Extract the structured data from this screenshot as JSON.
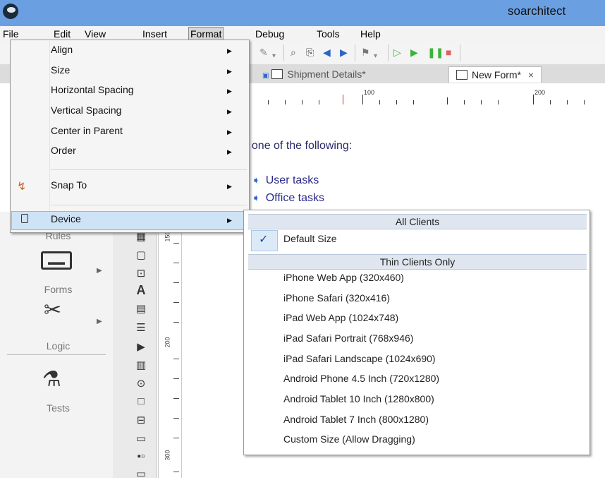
{
  "window": {
    "title": "soarchitect"
  },
  "menubar": {
    "items": [
      "File",
      "Edit",
      "View",
      "Insert",
      "Format",
      "Debug",
      "Tools",
      "Help"
    ]
  },
  "tabs": [
    {
      "label": "Shipment Details*"
    },
    {
      "label": "New Form*",
      "close": "×"
    }
  ],
  "ruler": {
    "marks": [
      "100",
      "200"
    ]
  },
  "vruler": {
    "marks": [
      "150",
      "200",
      "300"
    ]
  },
  "canvas": {
    "prompt": "ct one of the following:",
    "links": [
      "User tasks",
      "Office tasks"
    ]
  },
  "sidebar": {
    "sections": [
      "Rules",
      "Forms",
      "Logic",
      "Tests"
    ]
  },
  "palette": {
    "icons": [
      "text-icon"
    ]
  },
  "format_menu": {
    "items": [
      "Align",
      "Size",
      "Horizontal Spacing",
      "Vertical Spacing",
      "Center in Parent",
      "Order",
      "Snap To",
      "Device"
    ]
  },
  "device_menu": {
    "header_all": "All Clients",
    "default": "Default Size",
    "header_thin": "Thin Clients Only",
    "items": [
      "iPhone Web App (320x460)",
      "iPhone Safari (320x416)",
      "iPad Web App (1024x748)",
      "iPad Safari Portrait (768x946)",
      "iPad Safari Landscape (1024x690)",
      "Android Phone 4.5 Inch (720x1280)",
      "Android Tablet 10 Inch (1280x800)",
      "Android Tablet 7 Inch (800x1280)",
      "Custom Size (Allow Dragging)"
    ]
  }
}
